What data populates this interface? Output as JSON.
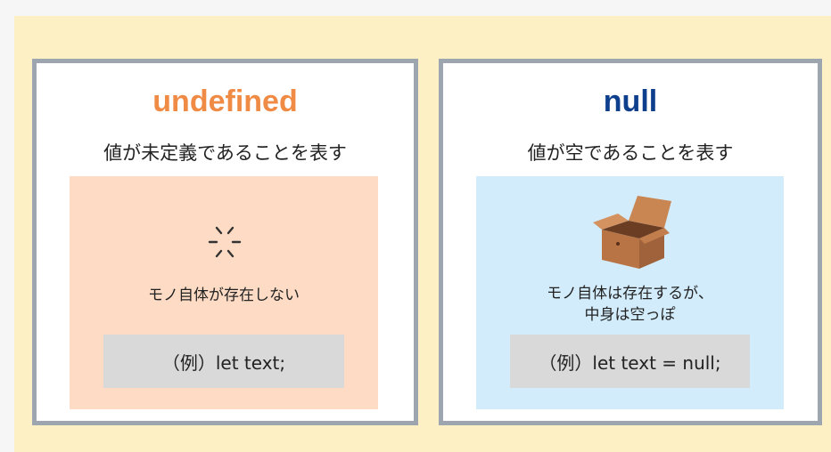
{
  "undefined_card": {
    "title": "undefined",
    "subtitle": "値が未定義であることを表す",
    "icon": "sparkle-icon",
    "description": "モノ自体が存在しない",
    "code": "（例）let text;"
  },
  "null_card": {
    "title": "null",
    "subtitle": "値が空であることを表す",
    "icon": "empty-box-icon",
    "description_line1": "モノ自体は存在するが、",
    "description_line2": "中身は空っぽ",
    "code": "（例）let text = null;"
  },
  "colors": {
    "background": "#fdf0c5",
    "undefined_title": "#ef8b45",
    "null_title": "#0d3f8c",
    "undefined_panel": "#fddbc4",
    "null_panel": "#d3ecfb",
    "code_box": "#d9d9d9",
    "card_border": "#9da6ae"
  }
}
